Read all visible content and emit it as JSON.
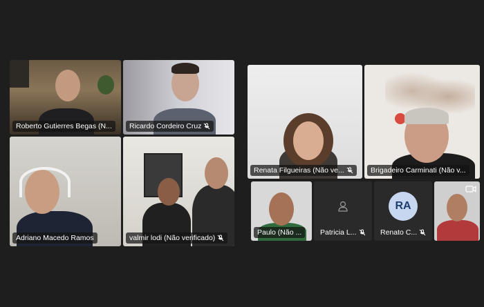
{
  "left_grid": {
    "participants": [
      {
        "name": "Roberto Gutierres Begas (N...",
        "muted": false
      },
      {
        "name": "Ricardo Cordeiro Cruz",
        "muted": true
      },
      {
        "name": "Adriano Macedo Ramos",
        "muted": false
      },
      {
        "name": "valmir lodi (Não verificado)",
        "muted": true
      }
    ]
  },
  "right_grid": {
    "participants": [
      {
        "name": "Renata Filgueiras (Não ve...",
        "muted": true
      },
      {
        "name": "Brigadeiro Carminati (Não v...",
        "muted": false
      },
      {
        "name": "Paulo (Não ...",
        "muted": false
      },
      {
        "name": "Patricia L...",
        "muted": true
      },
      {
        "name": "Renato C...",
        "muted": true,
        "initials": "RA"
      },
      {
        "name": "",
        "muted": false
      }
    ]
  },
  "icons": {
    "mic_muted": "mic-muted-icon",
    "person": "person-icon",
    "camera": "camera-switch-icon"
  },
  "colors": {
    "background": "#1e1e1e",
    "avatar_bg": "#c7d7f0",
    "avatar_text": "#1d3c6e"
  }
}
